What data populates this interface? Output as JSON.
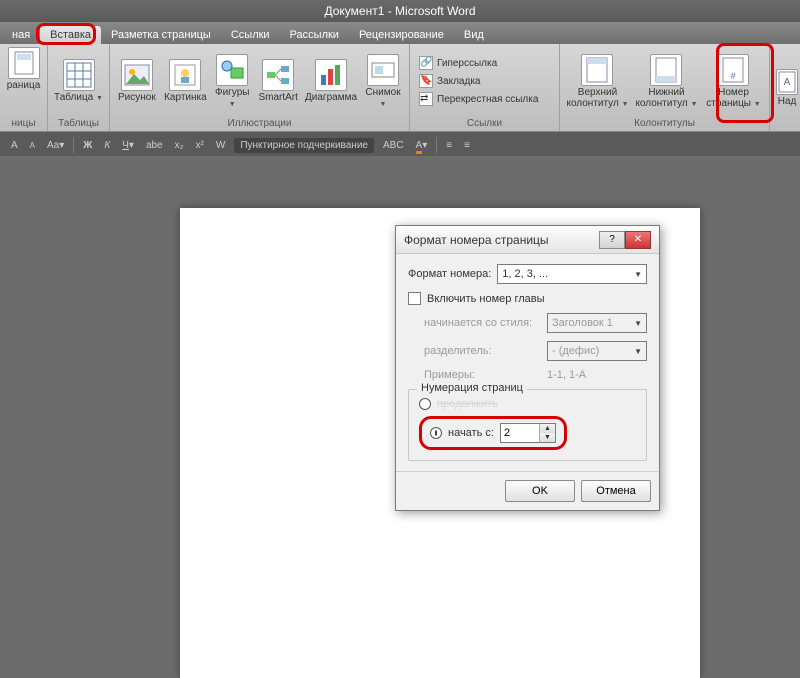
{
  "title": "Документ1 - Microsoft Word",
  "tabs": [
    "ная",
    "Вставка",
    "Разметка страницы",
    "Ссылки",
    "Рассылки",
    "Рецензирование",
    "Вид"
  ],
  "active_tab": 1,
  "ribbon": {
    "pages": {
      "label": "ницы",
      "btn1": "раница",
      "btn2": ""
    },
    "tables": {
      "label": "Таблицы",
      "btn": "Таблица"
    },
    "illustrations": {
      "label": "Иллюстрации",
      "btns": [
        "Рисунок",
        "Картинка",
        "Фигуры",
        "SmartArt",
        "Диаграмма",
        "Снимок"
      ]
    },
    "links": {
      "label": "Ссылки",
      "items": [
        "Гиперссылка",
        "Закладка",
        "Перекрестная ссылка"
      ]
    },
    "headers": {
      "label": "Колонтитулы",
      "btns": [
        "Верхний колонтитул",
        "Нижний колонтитул",
        "Номер страницы"
      ]
    },
    "text": {
      "label": "",
      "btn": "Над"
    }
  },
  "quick": {
    "items": [
      "A",
      "A",
      "Aa",
      "B",
      "I",
      "U",
      "W"
    ],
    "dotted": "Пунктирное подчеркивание"
  },
  "dialog": {
    "title": "Формат номера страницы",
    "format_label": "Формат номера:",
    "format_value": "1, 2, 3, ...",
    "include_chapter": "Включить номер главы",
    "style_label": "начинается со стиля:",
    "style_value": "Заголовок 1",
    "separator_label": "разделитель:",
    "separator_value": "-   (дефис)",
    "examples_label": "Примеры:",
    "examples_value": "1-1, 1-A",
    "numbering_legend": "Нумерация страниц",
    "continue": "продолжить",
    "start_at": "начать с:",
    "start_value": "2",
    "ok": "OK",
    "cancel": "Отмена"
  }
}
